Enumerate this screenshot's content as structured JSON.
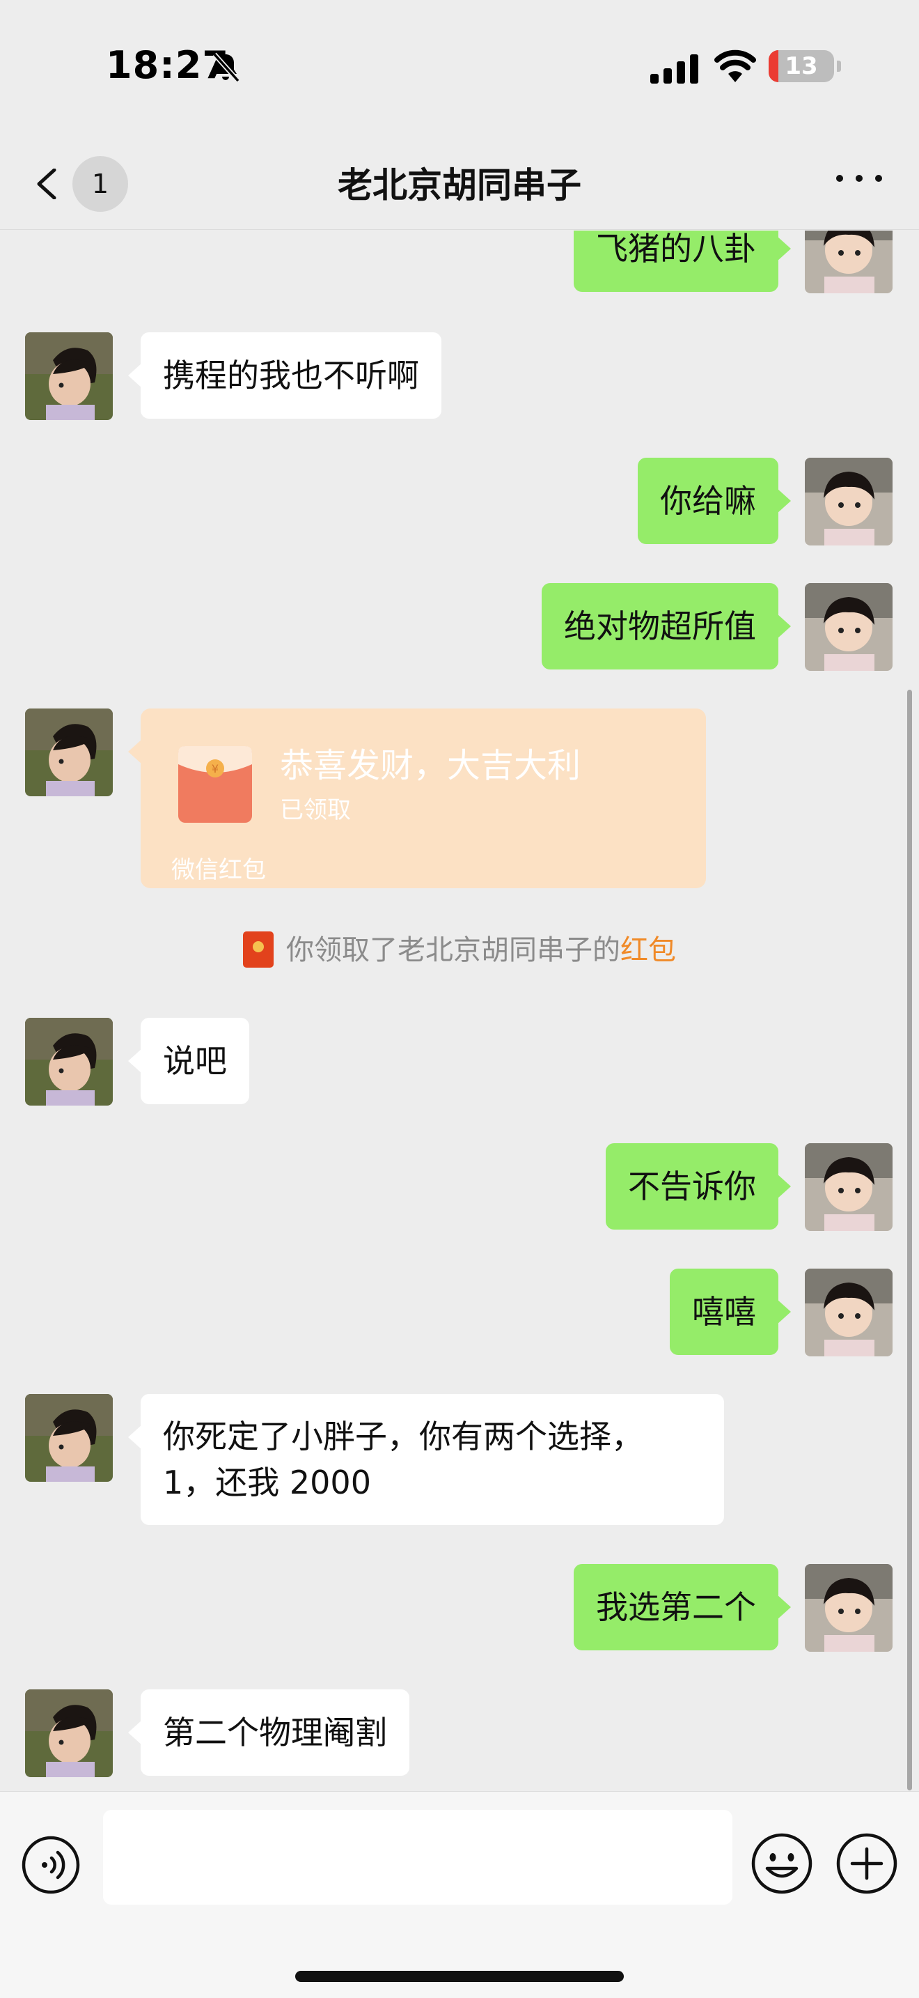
{
  "status_bar": {
    "time": "18:27",
    "battery_level": "13",
    "icons": [
      "bell-slash-icon",
      "cellular-signal-icon",
      "wifi-icon",
      "battery-icon"
    ]
  },
  "nav": {
    "back_icon": "chevron-left-icon",
    "unread_count": "1",
    "title": "老北京胡同串子",
    "more_icon": "ellipsis-icon"
  },
  "messages": [
    {
      "side": "right",
      "text": "飞猪的八卦"
    },
    {
      "side": "left",
      "text": "携程的我也不听啊"
    },
    {
      "side": "right",
      "text": "你给嘛"
    },
    {
      "side": "right",
      "text": "绝对物超所值"
    },
    {
      "side": "left",
      "type": "red_packet"
    },
    {
      "side": "left",
      "text": "说吧"
    },
    {
      "side": "right",
      "text": "不告诉你"
    },
    {
      "side": "right",
      "text": "嘻嘻"
    },
    {
      "side": "left",
      "text_line1": "你死定了小胖子，你有两个选择，",
      "text_line2": "1，还我 2000"
    },
    {
      "side": "right",
      "text": "我选第二个"
    },
    {
      "side": "left",
      "text": "第二个物理阉割"
    }
  ],
  "red_packet": {
    "title": "恭喜发财，大吉大利",
    "status": "已领取",
    "brand": "微信红包",
    "color": "#fce1c4"
  },
  "system_note": {
    "prefix": "你领取了老北京胡同串子的",
    "highlight": "红包",
    "highlight_color": "#f08a28"
  },
  "input_bar": {
    "placeholder": "",
    "icons": [
      "voice-icon",
      "emoji-icon",
      "plus-icon"
    ]
  },
  "colors": {
    "background": "#ededed",
    "sent_bubble": "#95ec69",
    "received_bubble": "#ffffff"
  }
}
